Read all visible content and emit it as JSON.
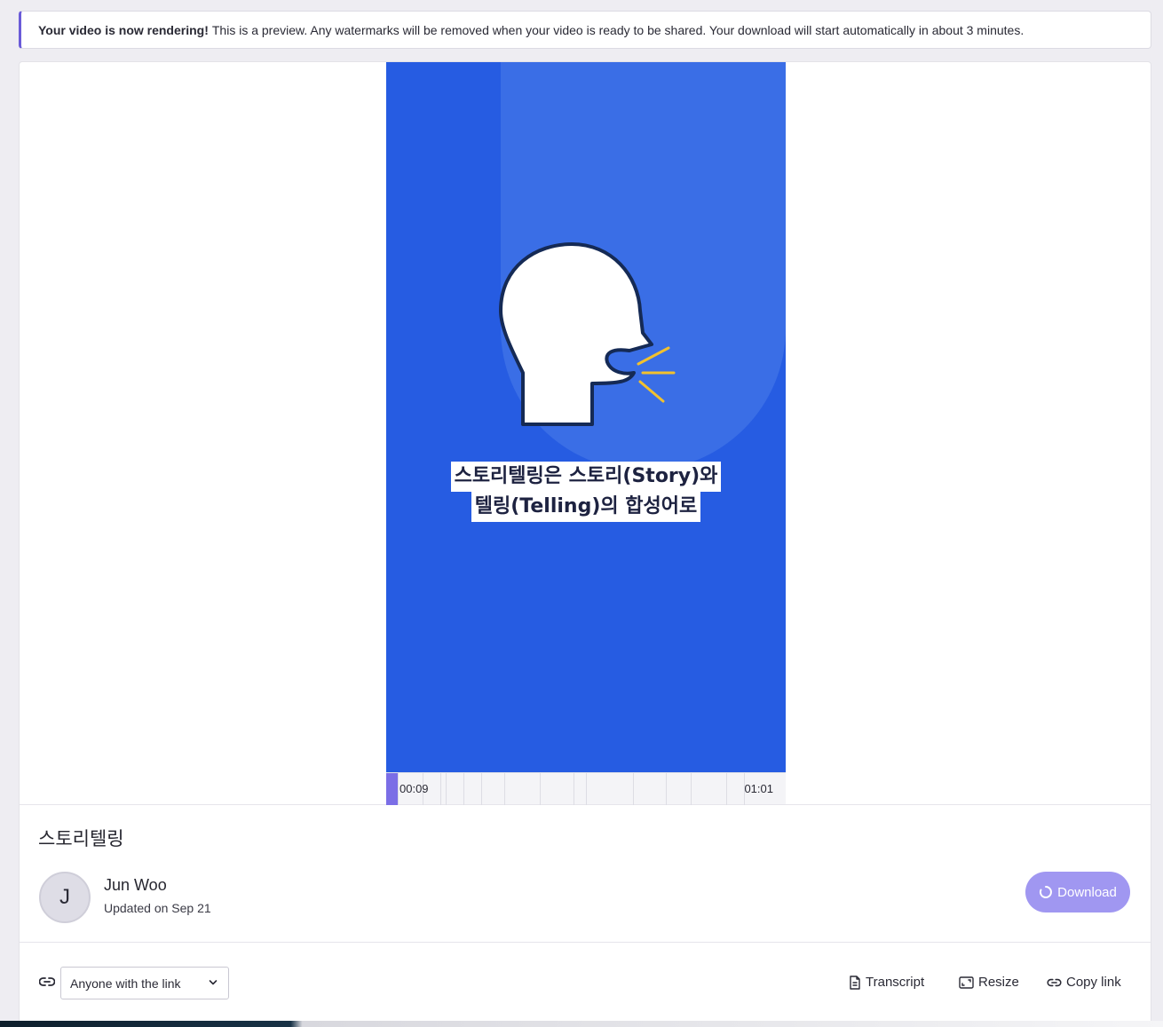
{
  "banner": {
    "bold": "Your video is now rendering!",
    "text": "This is a preview. Any watermarks will be removed when your video is ready to be shared. Your download will start automatically in about 3 minutes."
  },
  "video": {
    "caption_line1": "스토리텔링은 스토리(Story)와",
    "caption_line2": "텔링(Telling)의 합성어로",
    "current_time": "00:09",
    "duration": "01:01",
    "progress_fraction": 0.147
  },
  "info": {
    "title": "스토리텔링",
    "avatar_letter": "J",
    "author": "Jun Woo",
    "updated": "Updated on Sep 21",
    "download_label": "Download"
  },
  "share": {
    "access_value": "Anyone with the link",
    "transcript_label": "Transcript",
    "resize_label": "Resize",
    "copy_link_label": "Copy link"
  },
  "colors": {
    "accent": "#6a5bd8",
    "video_bg": "#265ce2",
    "download_bg": "#a097f1"
  },
  "icons": [
    "link-icon",
    "chevron-down-icon",
    "document-icon",
    "resize-icon",
    "spinner-icon",
    "speaking-head-icon"
  ]
}
